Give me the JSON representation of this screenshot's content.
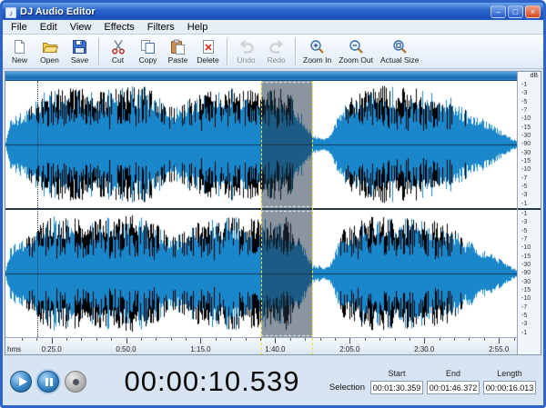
{
  "window": {
    "title": "DJ Audio Editor",
    "controls": {
      "minimize": "–",
      "maximize": "□",
      "close": "×"
    }
  },
  "menu": {
    "items": [
      "File",
      "Edit",
      "View",
      "Effects",
      "Filters",
      "Help"
    ]
  },
  "toolbar": {
    "groups": [
      [
        {
          "label": "New",
          "icon": "new-document-icon",
          "enabled": true
        },
        {
          "label": "Open",
          "icon": "open-folder-icon",
          "enabled": true
        },
        {
          "label": "Save",
          "icon": "save-icon",
          "enabled": true
        }
      ],
      [
        {
          "label": "Cut",
          "icon": "scissors-icon",
          "enabled": true
        },
        {
          "label": "Copy",
          "icon": "copy-icon",
          "enabled": true
        },
        {
          "label": "Paste",
          "icon": "paste-icon",
          "enabled": true
        },
        {
          "label": "Delete",
          "icon": "delete-icon",
          "enabled": true
        }
      ],
      [
        {
          "label": "Undo",
          "icon": "undo-icon",
          "enabled": false
        },
        {
          "label": "Redo",
          "icon": "redo-icon",
          "enabled": false
        }
      ],
      [
        {
          "label": "Zoom In",
          "icon": "zoom-in-icon",
          "enabled": true
        },
        {
          "label": "Zoom Out",
          "icon": "zoom-out-icon",
          "enabled": true
        },
        {
          "label": "Actual Size",
          "icon": "actual-size-icon",
          "enabled": true
        }
      ]
    ]
  },
  "waveform": {
    "db_label": "dB",
    "db_scale": [
      "-1",
      "-3",
      "-5",
      "-7",
      "-10",
      "-15",
      "-30",
      "-90",
      "-30",
      "-15",
      "-10",
      "-7",
      "-5",
      "-3",
      "-1"
    ],
    "timeline_unit": "hms",
    "timeline_ticks": [
      "0:25.0",
      "0:50.0",
      "1:15.0",
      "1:40.0",
      "2:05.0",
      "2:30.0",
      "2:55.0"
    ],
    "selection": {
      "start_frac": 0.5,
      "end_frac": 0.6
    },
    "cursor_frac": 0.062,
    "colors": {
      "wave": "#1b87cb",
      "peak": "#000000",
      "center": "#0b3a5c",
      "selection_overlay": "rgba(30,52,70,0.52)",
      "background": "#ffffff"
    },
    "envelope": [
      [
        0,
        0.05
      ],
      [
        0.01,
        0.45
      ],
      [
        0.05,
        0.62
      ],
      [
        0.08,
        0.92
      ],
      [
        0.18,
        0.88
      ],
      [
        0.27,
        0.95
      ],
      [
        0.33,
        0.58
      ],
      [
        0.38,
        0.85
      ],
      [
        0.45,
        0.9
      ],
      [
        0.5,
        0.86
      ],
      [
        0.55,
        0.9
      ],
      [
        0.585,
        0.4
      ],
      [
        0.6,
        0.15
      ],
      [
        0.63,
        0.1
      ],
      [
        0.66,
        0.7
      ],
      [
        0.72,
        0.95
      ],
      [
        0.8,
        0.9
      ],
      [
        0.86,
        0.85
      ],
      [
        0.9,
        0.55
      ],
      [
        0.95,
        0.35
      ],
      [
        0.98,
        0.15
      ],
      [
        1,
        0.05
      ]
    ]
  },
  "status": {
    "time_display": "00:00:10.539",
    "selection_label": "Selection",
    "fields": [
      {
        "label": "Start",
        "value": "00:01:30.359"
      },
      {
        "label": "End",
        "value": "00:01:46.372"
      },
      {
        "label": "Length",
        "value": "00:00:16.013"
      }
    ]
  }
}
